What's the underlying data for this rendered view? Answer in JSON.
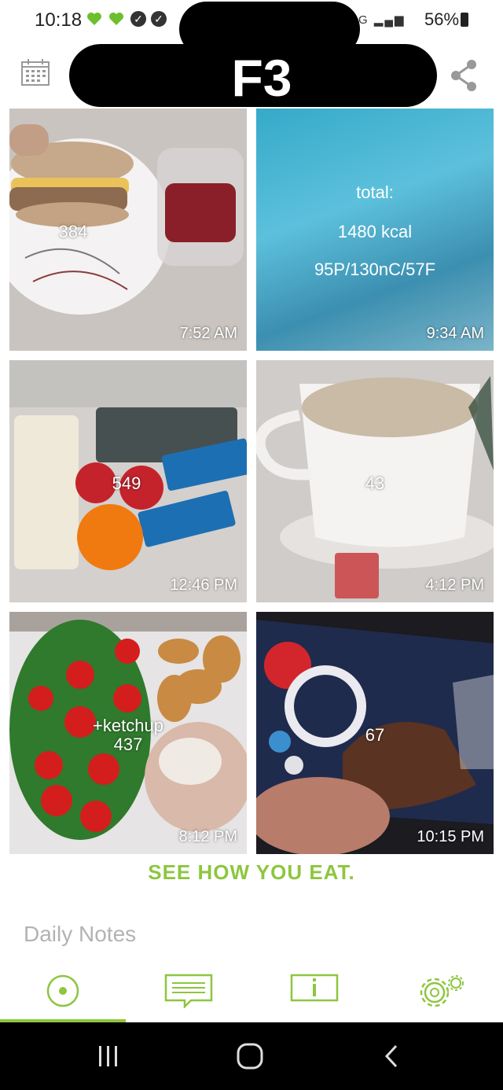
{
  "status_bar": {
    "time": "10:18",
    "battery": "56%",
    "network": "4G"
  },
  "header": {
    "title": "F3"
  },
  "entries": [
    {
      "calories": "384",
      "time": "7:52 AM"
    },
    {
      "total_label": "total:",
      "total_kcal": "1480 kcal",
      "macros": "95P/130nC/57F",
      "time": "9:34 AM"
    },
    {
      "calories": "549",
      "time": "12:46 PM"
    },
    {
      "calories": "43",
      "time": "4:12 PM"
    },
    {
      "note": "+ketchup",
      "calories": "437",
      "time": "8:12 PM"
    },
    {
      "calories": "67",
      "time": "10:15 PM"
    }
  ],
  "slogan": "SEE HOW YOU EAT.",
  "notes_placeholder": "Daily Notes",
  "tabs": [
    "camera-tab",
    "notes-tab",
    "info-tab",
    "settings-tab"
  ],
  "colors": {
    "accent": "#8dc63f",
    "nav_bg": "#000000"
  }
}
